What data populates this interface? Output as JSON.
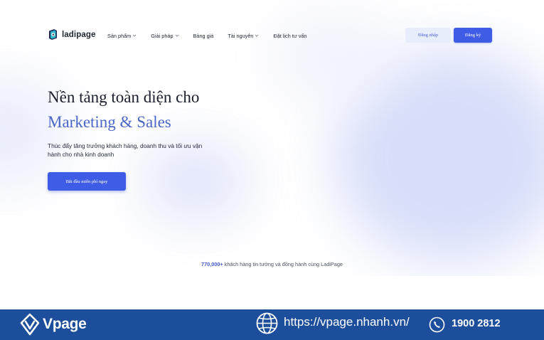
{
  "brand": {
    "name": "ladipage",
    "logo_icon": "ladipage-logo-icon"
  },
  "nav": {
    "items": [
      {
        "label": "Sản phẩm",
        "has_dropdown": true
      },
      {
        "label": "Giải pháp",
        "has_dropdown": true
      },
      {
        "label": "Bảng giá",
        "has_dropdown": false
      },
      {
        "label": "Tài nguyên",
        "has_dropdown": true
      },
      {
        "label": "Đặt lịch tư vấn",
        "has_dropdown": false
      }
    ],
    "login_label": "Đăng nhập",
    "signup_label": "Đăng ký"
  },
  "hero": {
    "title_line1": "Nền tảng toàn diện cho",
    "title_line2": "Marketing & Sales",
    "description": "Thúc đẩy tăng trưởng khách hàng, doanh thu và tối ưu vận hành cho nhà kinh doanh",
    "cta_label": "Bắt đầu miễn phí ngay"
  },
  "trust": {
    "count": "770,000+",
    "text": "khách hàng tin tưởng và đồng hành cùng LadiPage"
  },
  "footer": {
    "brand": "Vpage",
    "url": "https://vpage.nhanh.vn/",
    "phone": "1900 2812",
    "icons": [
      "vpage-logo-icon",
      "globe-icon",
      "phone-icon"
    ]
  },
  "colors": {
    "accent": "#3f5ce6",
    "accent_light": "#e8edfb",
    "title_accent": "#4a66c6",
    "footer_bg": "#1c4e9c",
    "text": "#1b1f2c"
  }
}
